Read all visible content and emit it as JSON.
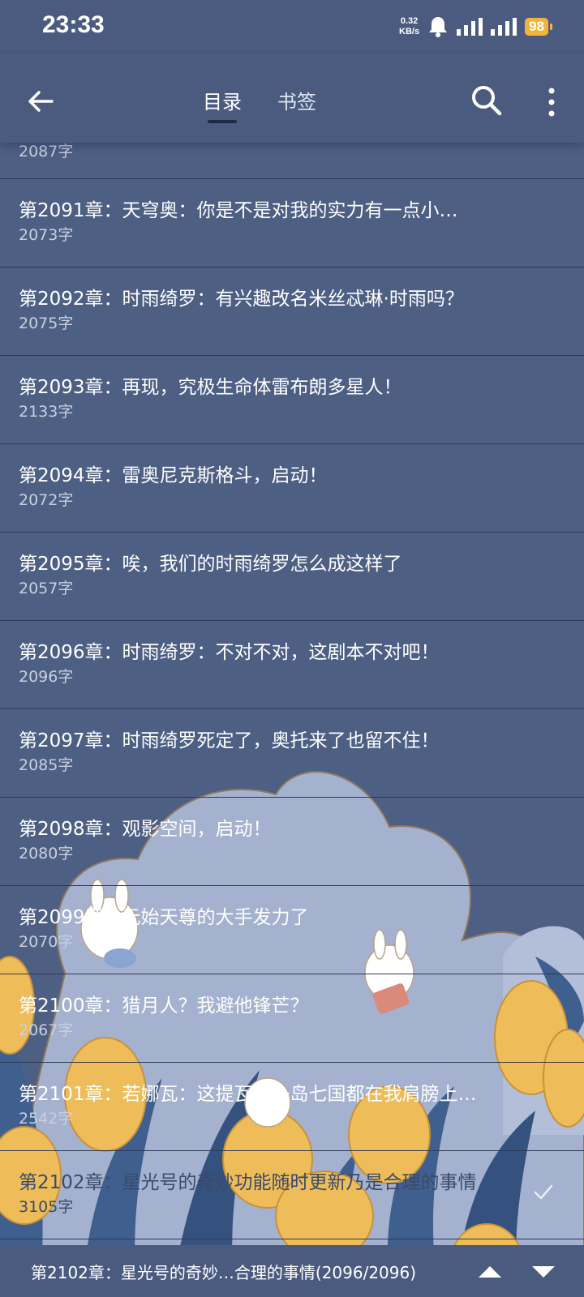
{
  "status_bar": {
    "time": "23:33",
    "net_speed_value": "0.32",
    "net_speed_unit": "KB/s",
    "battery": "98"
  },
  "top_bar": {
    "tabs": [
      {
        "label": "目录",
        "active": true
      },
      {
        "label": "书签",
        "active": false
      }
    ]
  },
  "chapters": [
    {
      "title": "",
      "words": "2087字"
    },
    {
      "title": "第2091章：天穹奥：你是不是对我的实力有一点小…",
      "words": "2073字"
    },
    {
      "title": "第2092章：时雨绮罗：有兴趣改名米丝忒琳·时雨吗？",
      "words": "2075字"
    },
    {
      "title": "第2093章：再现，究极生命体雷布朗多星人！",
      "words": "2133字"
    },
    {
      "title": "第2094章：雷奥尼克斯格斗，启动！",
      "words": "2072字"
    },
    {
      "title": "第2095章：唉，我们的时雨绮罗怎么成这样了",
      "words": "2057字"
    },
    {
      "title": "第2096章：时雨绮罗：不对不对，这剧本不对吧！",
      "words": "2096字"
    },
    {
      "title": "第2097章：时雨绮罗死定了，奥托来了也留不住！",
      "words": "2085字"
    },
    {
      "title": "第2098章：观影空间，启动！",
      "words": "2080字"
    },
    {
      "title": "第2099章：元始天尊的大手发力了",
      "words": "2070字"
    },
    {
      "title": "第2100章：猎月人？我避他锋芒？",
      "words": "2067字"
    },
    {
      "title": "第2101章：若娜瓦：这提瓦特一岛七国都在我肩膀上…",
      "words": "2542字"
    },
    {
      "title": "第2102章：星光号的奇妙功能随时更新乃是合理的事情",
      "words": "3105字",
      "current": true
    }
  ],
  "bottom_bar": {
    "current_chapter": "第2102章：星光号的奇妙…合理的事情(2096/2096)"
  },
  "colors": {
    "background": "#4e5f84",
    "bar": "#4b5b80",
    "battery": "#f2b33d"
  },
  "icons": [
    "back-arrow-icon",
    "search-icon",
    "more-vertical-icon",
    "check-icon",
    "triangle-up-icon",
    "triangle-down-icon"
  ]
}
